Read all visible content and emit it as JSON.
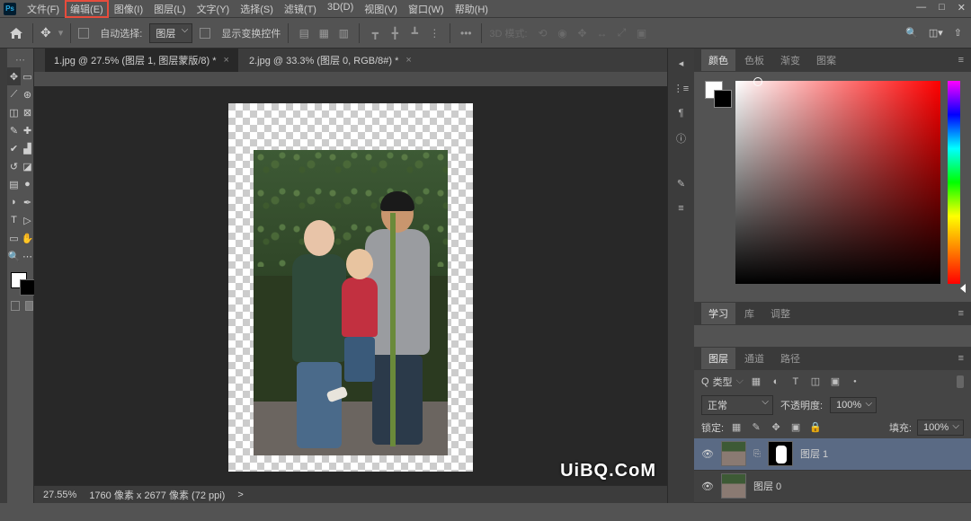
{
  "menubar": {
    "items": [
      "文件(F)",
      "编辑(E)",
      "图像(I)",
      "图层(L)",
      "文字(Y)",
      "选择(S)",
      "滤镜(T)",
      "3D(D)",
      "视图(V)",
      "窗口(W)",
      "帮助(H)"
    ],
    "highlighted_index": 1
  },
  "window_controls": {
    "min": "—",
    "max": "□",
    "close": "✕"
  },
  "optbar": {
    "auto_select": "自动选择:",
    "layer_dropdown": "图层",
    "show_transform": "显示变换控件",
    "mode_3d": "3D 模式:"
  },
  "tabs": [
    {
      "label": "1.jpg @ 27.5% (图层 1, 图层蒙版/8) *",
      "active": true
    },
    {
      "label": "2.jpg @ 33.3% (图层 0, RGB/8#) *",
      "active": false
    }
  ],
  "statusbar": {
    "zoom": "27.55%",
    "dims": "1760 像素 x 2677 像素 (72 ppi)",
    "caret": ">"
  },
  "color_tabs": [
    "颜色",
    "色板",
    "渐变",
    "图案"
  ],
  "mid_tabs": [
    "学习",
    "库",
    "调整"
  ],
  "layer_tabs": [
    "图层",
    "通道",
    "路径"
  ],
  "layer_panel": {
    "kind": "类型",
    "search_icon": "Q",
    "blend": "正常",
    "opacity_label": "不透明度:",
    "opacity_value": "100%",
    "lock_label": "锁定:",
    "fill_label": "填充:",
    "fill_value": "100%"
  },
  "layers": [
    {
      "name": "图层 1",
      "has_mask": true,
      "selected": true,
      "visible": true
    },
    {
      "name": "图层 0",
      "has_mask": false,
      "selected": false,
      "visible": true
    }
  ],
  "watermark": "UiBQ.CoM"
}
